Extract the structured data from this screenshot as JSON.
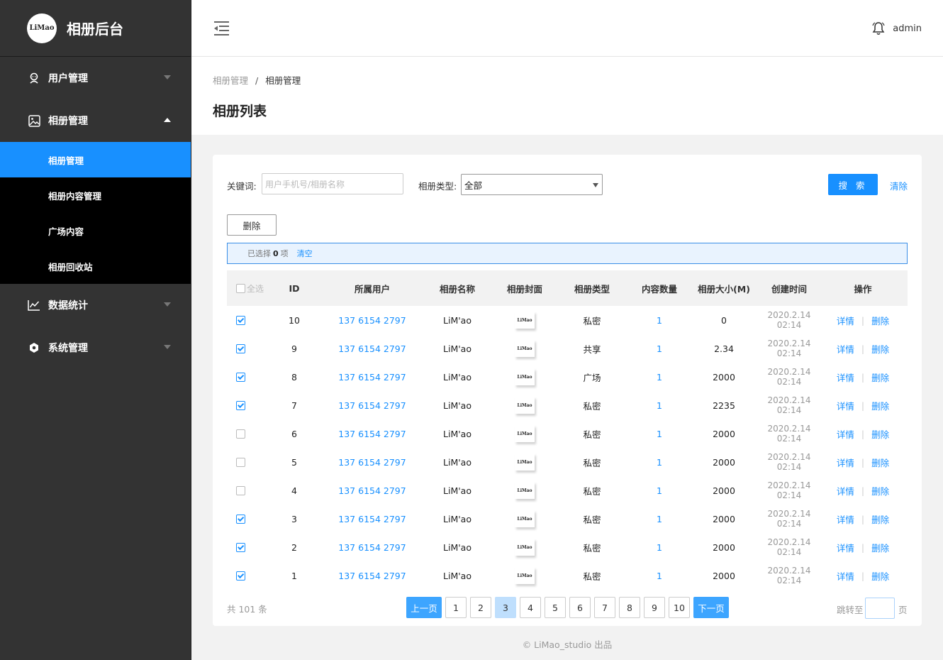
{
  "sidebar": {
    "logo_text": "LiMao",
    "title": "相册后台",
    "menu": [
      {
        "label": "用户管理",
        "icon": "user-icon",
        "expanded": false
      },
      {
        "label": "相册管理",
        "icon": "image-icon",
        "expanded": true,
        "children": [
          {
            "label": "相册管理",
            "active": true
          },
          {
            "label": "相册内容管理",
            "active": false
          },
          {
            "label": "广场内容",
            "active": false
          },
          {
            "label": "相册回收站",
            "active": false
          }
        ]
      },
      {
        "label": "数据统计",
        "icon": "chart-line-icon",
        "expanded": false
      },
      {
        "label": "系统管理",
        "icon": "settings-icon",
        "expanded": false
      }
    ]
  },
  "header": {
    "user": "admin"
  },
  "breadcrumb": {
    "parent": "相册管理",
    "sep": "/",
    "current": "相册管理"
  },
  "page_title": "相册列表",
  "filters": {
    "keyword_label": "关键词:",
    "keyword_placeholder": "用户手机号/相册名称",
    "keyword_value": "",
    "type_label": "相册类型:",
    "type_value": "全部",
    "search_label": "搜 索",
    "clear_label": "清除"
  },
  "toolbar": {
    "delete_label": "删除"
  },
  "selection": {
    "prefix": "已选择",
    "count": "0",
    "suffix": "项",
    "clear": "清空"
  },
  "table": {
    "select_all": "全选",
    "headers": [
      "ID",
      "所属用户",
      "相册名称",
      "相册封面",
      "相册类型",
      "内容数量",
      "相册大小(M)",
      "创建时间",
      "操作"
    ],
    "detail_label": "详情",
    "delete_label": "删除",
    "cover_text": "LiMao",
    "rows": [
      {
        "checked": true,
        "id": "10",
        "user": "137 6154 2797",
        "name": "LiM'ao",
        "type": "私密",
        "count": "1",
        "size": "0",
        "date": "2020.2.14",
        "time": "02:14"
      },
      {
        "checked": true,
        "id": "9",
        "user": "137 6154 2797",
        "name": "LiM'ao",
        "type": "共享",
        "count": "1",
        "size": "2.34",
        "date": "2020.2.14",
        "time": "02:14"
      },
      {
        "checked": true,
        "id": "8",
        "user": "137 6154 2797",
        "name": "LiM'ao",
        "type": "广场",
        "count": "1",
        "size": "2000",
        "date": "2020.2.14",
        "time": "02:14"
      },
      {
        "checked": true,
        "id": "7",
        "user": "137 6154 2797",
        "name": "LiM'ao",
        "type": "私密",
        "count": "1",
        "size": "2235",
        "date": "2020.2.14",
        "time": "02:14"
      },
      {
        "checked": false,
        "id": "6",
        "user": "137 6154 2797",
        "name": "LiM'ao",
        "type": "私密",
        "count": "1",
        "size": "2000",
        "date": "2020.2.14",
        "time": "02:14"
      },
      {
        "checked": false,
        "id": "5",
        "user": "137 6154 2797",
        "name": "LiM'ao",
        "type": "私密",
        "count": "1",
        "size": "2000",
        "date": "2020.2.14",
        "time": "02:14"
      },
      {
        "checked": false,
        "id": "4",
        "user": "137 6154 2797",
        "name": "LiM'ao",
        "type": "私密",
        "count": "1",
        "size": "2000",
        "date": "2020.2.14",
        "time": "02:14"
      },
      {
        "checked": true,
        "id": "3",
        "user": "137 6154 2797",
        "name": "LiM'ao",
        "type": "私密",
        "count": "1",
        "size": "2000",
        "date": "2020.2.14",
        "time": "02:14"
      },
      {
        "checked": true,
        "id": "2",
        "user": "137 6154 2797",
        "name": "LiM'ao",
        "type": "私密",
        "count": "1",
        "size": "2000",
        "date": "2020.2.14",
        "time": "02:14"
      },
      {
        "checked": true,
        "id": "1",
        "user": "137 6154 2797",
        "name": "LiM'ao",
        "type": "私密",
        "count": "1",
        "size": "2000",
        "date": "2020.2.14",
        "time": "02:14"
      }
    ]
  },
  "pagination": {
    "total": "共 101 条",
    "prev": "上一页",
    "next": "下一页",
    "pages": [
      "1",
      "2",
      "3",
      "4",
      "5",
      "6",
      "7",
      "8",
      "9",
      "10"
    ],
    "current": "3",
    "jump_label": "跳转至",
    "jump_unit": "页"
  },
  "footer": "©  LiMao_studio 出品",
  "colors": {
    "accent": "#1890ff",
    "sidebar_bg": "#333333",
    "submenu_bg": "#000000"
  }
}
